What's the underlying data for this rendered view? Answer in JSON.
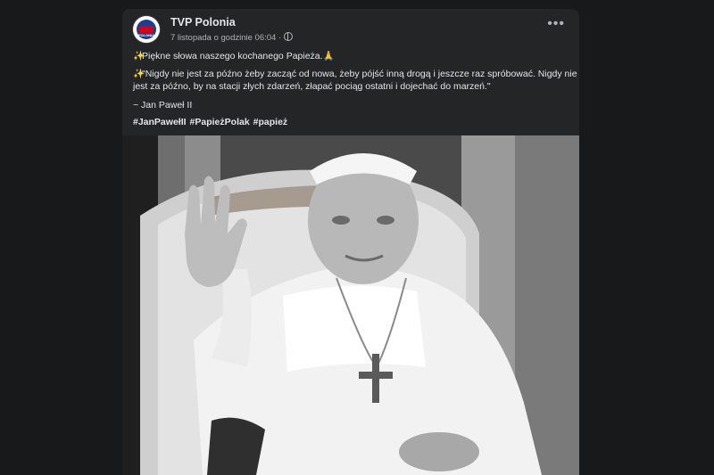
{
  "post": {
    "page_name": "TVP Polonia",
    "timestamp": "7 listopada o godzinie 06:04 ·",
    "more_label": "•••",
    "line1": "Piękne słowa naszego kochanego Papieża.",
    "quote": "\"Nigdy nie jest za późno żeby zacząć od nowa, żeby pójść inną drogą i jeszcze raz spróbować. Nigdy nie jest za późno, by na stacji złych zdarzeń, złapać pociąg ostatni i dojechać do marzeń.\"",
    "author": "~ Jan Paweł II",
    "hashtags": [
      "#JanPawełII",
      "#PapieżPolak",
      "#papież"
    ],
    "avatar_text": "POLONIA",
    "sparkle_emoji": "✨",
    "pray_emoji": "🙏"
  },
  "colors": {
    "background": "#18191a",
    "card": "#242526",
    "text": "#e4e6eb",
    "secondary_text": "#b0b3b8"
  }
}
